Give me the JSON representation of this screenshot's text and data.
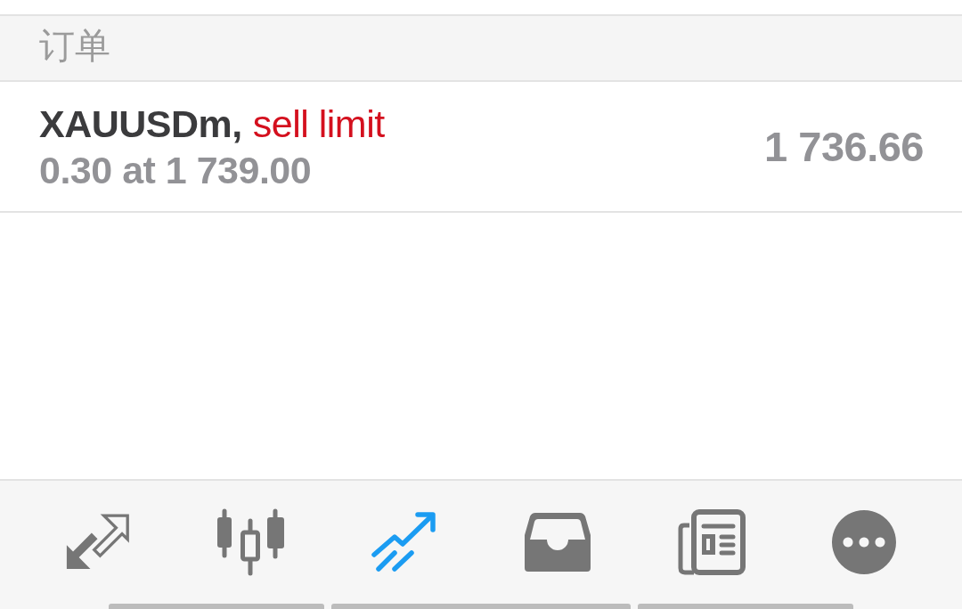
{
  "section": {
    "title": "订单"
  },
  "orders": [
    {
      "symbol": "XAUUSDm,",
      "type": "sell limit",
      "color": "#d4101e",
      "details": "0.30 at 1 739.00",
      "price": "1 736.66"
    }
  ],
  "tabs": [
    {
      "kind": "exchange",
      "selected": false
    },
    {
      "kind": "candles",
      "selected": false
    },
    {
      "kind": "trade",
      "selected": true
    },
    {
      "kind": "tray",
      "selected": false
    },
    {
      "kind": "news",
      "selected": false
    },
    {
      "kind": "more",
      "selected": false
    }
  ]
}
